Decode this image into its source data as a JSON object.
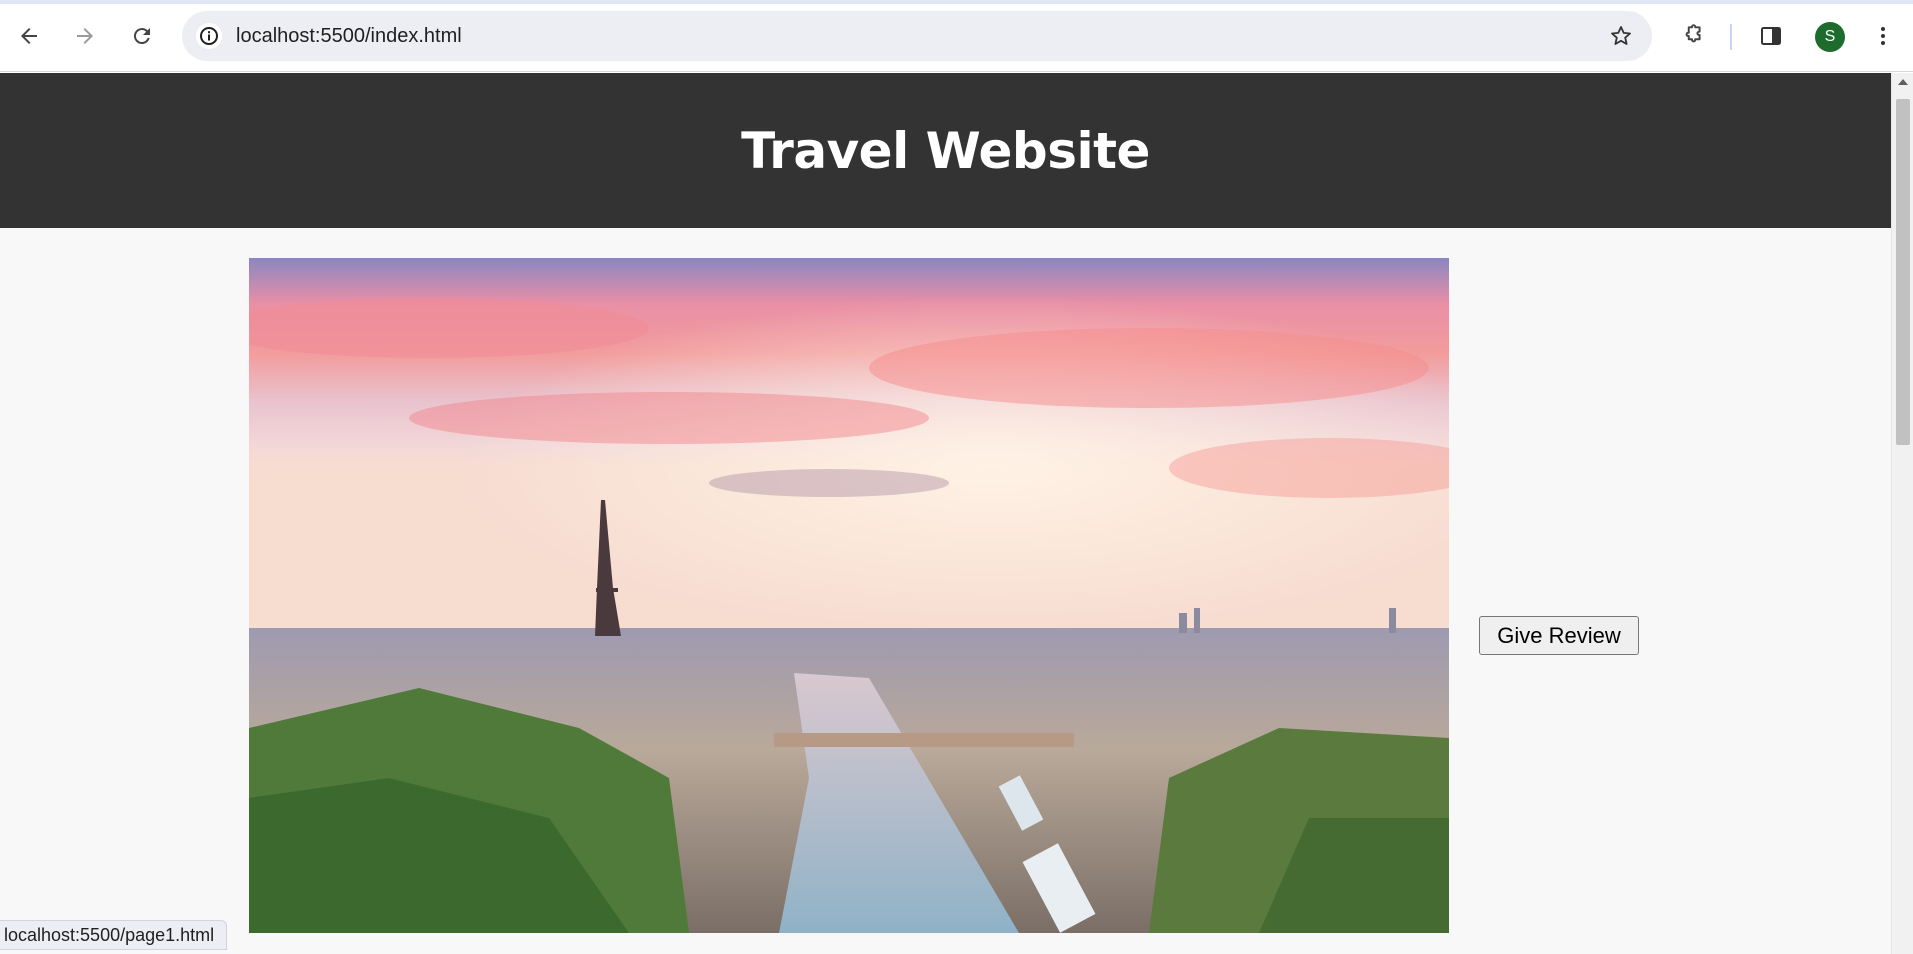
{
  "browser": {
    "url": "localhost:5500/index.html",
    "avatar_letter": "S",
    "status_url": "localhost:5500/page1.html",
    "icons": {
      "back": "arrow-left-icon",
      "forward": "arrow-right-icon",
      "reload": "reload-icon",
      "site_info": "info-icon",
      "bookmark": "star-icon",
      "extensions": "puzzle-icon",
      "side_panel": "side-panel-icon",
      "menu": "kebab-menu-icon"
    }
  },
  "page": {
    "header": {
      "title": "Travel Website",
      "background_color": "#333333"
    },
    "hero_image": {
      "alt": "Aerial view of Paris with the Eiffel Tower and the Seine at sunset"
    },
    "review_button": {
      "label": "Give Review"
    }
  }
}
